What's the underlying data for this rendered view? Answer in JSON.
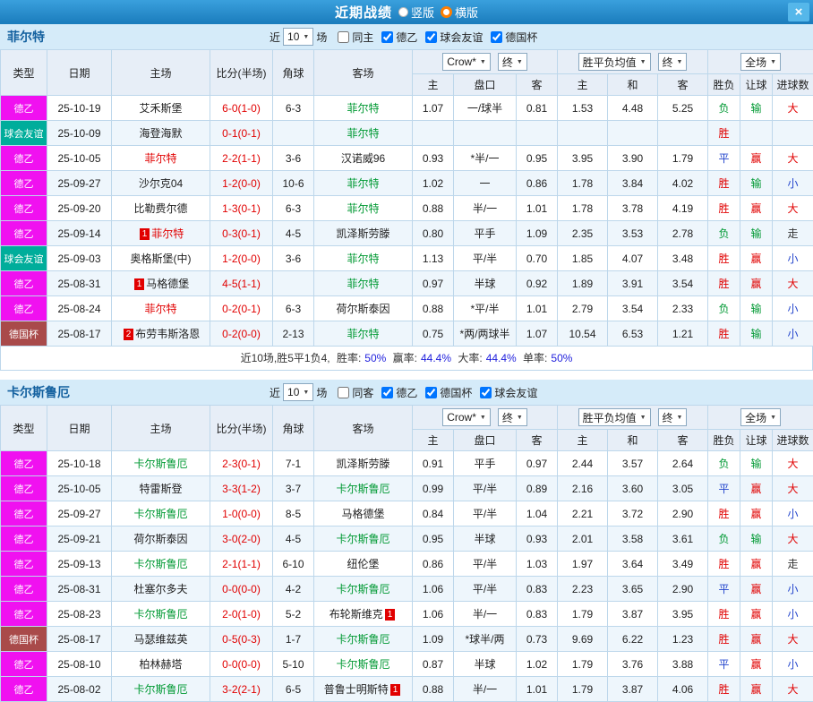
{
  "titlebar": {
    "title": "近期战绩",
    "vertical": "竖版",
    "horizontal": "横版",
    "close": "×"
  },
  "colors": {
    "header_bar": "#2187c8",
    "section_bar": "#d5ebf9",
    "grid": "#bdd7eb",
    "l2": "#f011f0",
    "fr": "#00ad9b",
    "cup": "#a94a4a",
    "red": "#e10000",
    "green": "#009933",
    "blue": "#2244cc",
    "black": "#222222",
    "dark": "#333333",
    "percent": "#2222dd",
    "orange": "#ff7e00"
  },
  "sections": [
    {
      "team": "菲尔特",
      "filter": {
        "near": "近",
        "count": "10",
        "games": "场",
        "checkboxes": [
          {
            "label": "同主",
            "checked": false
          },
          {
            "label": "德乙",
            "checked": true
          },
          {
            "label": "球会友谊",
            "checked": true
          },
          {
            "label": "德国杯",
            "checked": true
          }
        ]
      },
      "header": {
        "type": "类型",
        "date": "日期",
        "home": "主场",
        "score": "比分(半场)",
        "corner": "角球",
        "away": "客场",
        "odds_src": "Crow*",
        "odds_final": "终",
        "odds_cols": [
          "主",
          "盘口",
          "客"
        ],
        "avg_src": "胜平负均值",
        "avg_final": "终",
        "avg_cols": [
          "主",
          "和",
          "客"
        ],
        "scope": "全场",
        "result_cols": [
          "胜负",
          "让球",
          "进球数"
        ]
      },
      "rows": [
        {
          "tc": "l2",
          "type": "德乙",
          "date": "25-10-19",
          "home": "艾禾斯堡",
          "hc": "black",
          "score": "6-0(1-0)",
          "corner": "6-3",
          "away": "菲尔特",
          "ac": "green",
          "o1": "1.07",
          "o2": "一/球半",
          "o3": "0.81",
          "m1": "1.53",
          "m2": "4.48",
          "m3": "5.25",
          "rs": "负",
          "rc": "green",
          "hd": "输",
          "hdc": "green",
          "gl": "大",
          "glc": "red"
        },
        {
          "tc": "fr",
          "type": "球会友谊",
          "date": "25-10-09",
          "home": "海登海默",
          "hc": "black",
          "score": "0-1(0-1)",
          "corner": "",
          "away": "菲尔特",
          "ac": "green",
          "o1": "",
          "o2": "",
          "o3": "",
          "m1": "",
          "m2": "",
          "m3": "",
          "rs": "胜",
          "rc": "red",
          "hd": "",
          "hdc": "black",
          "gl": "",
          "glc": "black"
        },
        {
          "tc": "l2",
          "type": "德乙",
          "date": "25-10-05",
          "home": "菲尔特",
          "hc": "red",
          "score": "2-2(1-1)",
          "corner": "3-6",
          "away": "汉诺威96",
          "ac": "black",
          "o1": "0.93",
          "o2": "*半/一",
          "o3": "0.95",
          "m1": "3.95",
          "m2": "3.90",
          "m3": "1.79",
          "rs": "平",
          "rc": "blue",
          "hd": "赢",
          "hdc": "red",
          "gl": "大",
          "glc": "red"
        },
        {
          "tc": "l2",
          "type": "德乙",
          "date": "25-09-27",
          "home": "沙尔克04",
          "hc": "black",
          "score": "1-2(0-0)",
          "corner": "10-6",
          "away": "菲尔特",
          "ac": "green",
          "o1": "1.02",
          "o2": "一",
          "o3": "0.86",
          "m1": "1.78",
          "m2": "3.84",
          "m3": "4.02",
          "rs": "胜",
          "rc": "red",
          "hd": "输",
          "hdc": "green",
          "gl": "小",
          "glc": "blue"
        },
        {
          "tc": "l2",
          "type": "德乙",
          "date": "25-09-20",
          "home": "比勒费尔德",
          "hc": "black",
          "score": "1-3(0-1)",
          "corner": "6-3",
          "away": "菲尔特",
          "ac": "green",
          "o1": "0.88",
          "o2": "半/一",
          "o3": "1.01",
          "m1": "1.78",
          "m2": "3.78",
          "m3": "4.19",
          "rs": "胜",
          "rc": "red",
          "hd": "赢",
          "hdc": "red",
          "gl": "大",
          "glc": "red"
        },
        {
          "tc": "l2",
          "type": "德乙",
          "date": "25-09-14",
          "home": "菲尔特",
          "hc": "red",
          "hb": "1",
          "score": "0-3(0-1)",
          "corner": "4-5",
          "away": "凯泽斯劳滕",
          "ac": "black",
          "o1": "0.80",
          "o2": "平手",
          "o3": "1.09",
          "m1": "2.35",
          "m2": "3.53",
          "m3": "2.78",
          "rs": "负",
          "rc": "green",
          "hd": "输",
          "hdc": "green",
          "gl": "走",
          "glc": "dark"
        },
        {
          "tc": "fr",
          "type": "球会友谊",
          "date": "25-09-03",
          "home": "奥格斯堡(中)",
          "hc": "black",
          "score": "1-2(0-0)",
          "corner": "3-6",
          "away": "菲尔特",
          "ac": "green",
          "o1": "1.13",
          "o2": "平/半",
          "o3": "0.70",
          "m1": "1.85",
          "m2": "4.07",
          "m3": "3.48",
          "rs": "胜",
          "rc": "red",
          "hd": "赢",
          "hdc": "red",
          "gl": "小",
          "glc": "blue"
        },
        {
          "tc": "l2",
          "type": "德乙",
          "date": "25-08-31",
          "home": "马格德堡",
          "hc": "black",
          "hb": "1",
          "score": "4-5(1-1)",
          "corner": "",
          "away": "菲尔特",
          "ac": "green",
          "o1": "0.97",
          "o2": "半球",
          "o3": "0.92",
          "m1": "1.89",
          "m2": "3.91",
          "m3": "3.54",
          "rs": "胜",
          "rc": "red",
          "hd": "赢",
          "hdc": "red",
          "gl": "大",
          "glc": "red"
        },
        {
          "tc": "l2",
          "type": "德乙",
          "date": "25-08-24",
          "home": "菲尔特",
          "hc": "red",
          "score": "0-2(0-1)",
          "corner": "6-3",
          "away": "荷尔斯泰因",
          "ac": "black",
          "o1": "0.88",
          "o2": "*平/半",
          "o3": "1.01",
          "m1": "2.79",
          "m2": "3.54",
          "m3": "2.33",
          "rs": "负",
          "rc": "green",
          "hd": "输",
          "hdc": "green",
          "gl": "小",
          "glc": "blue"
        },
        {
          "tc": "cup",
          "type": "德国杯",
          "date": "25-08-17",
          "home": "布劳韦斯洛恩",
          "hc": "black",
          "hb": "2",
          "score": "0-2(0-0)",
          "corner": "2-13",
          "away": "菲尔特",
          "ac": "green",
          "o1": "0.75",
          "o2": "*两/两球半",
          "o3": "1.07",
          "m1": "10.54",
          "m2": "6.53",
          "m3": "1.21",
          "rs": "胜",
          "rc": "red",
          "hd": "输",
          "hdc": "green",
          "gl": "小",
          "glc": "blue"
        }
      ],
      "summary": {
        "prefix": "近10场,胜5平1负4,",
        "items": [
          {
            "label": "胜率:",
            "value": "50%"
          },
          {
            "label": "赢率:",
            "value": "44.4%"
          },
          {
            "label": "大率:",
            "value": "44.4%"
          },
          {
            "label": "单率:",
            "value": "50%"
          }
        ]
      }
    },
    {
      "team": "卡尔斯鲁厄",
      "filter": {
        "near": "近",
        "count": "10",
        "games": "场",
        "checkboxes": [
          {
            "label": "同客",
            "checked": false
          },
          {
            "label": "德乙",
            "checked": true
          },
          {
            "label": "德国杯",
            "checked": true
          },
          {
            "label": "球会友谊",
            "checked": true
          }
        ]
      },
      "header": {
        "type": "类型",
        "date": "日期",
        "home": "主场",
        "score": "比分(半场)",
        "corner": "角球",
        "away": "客场",
        "odds_src": "Crow*",
        "odds_final": "终",
        "odds_cols": [
          "主",
          "盘口",
          "客"
        ],
        "avg_src": "胜平负均值",
        "avg_final": "终",
        "avg_cols": [
          "主",
          "和",
          "客"
        ],
        "scope": "全场",
        "result_cols": [
          "胜负",
          "让球",
          "进球数"
        ]
      },
      "rows": [
        {
          "tc": "l2",
          "type": "德乙",
          "date": "25-10-18",
          "home": "卡尔斯鲁厄",
          "hc": "green",
          "score": "2-3(0-1)",
          "corner": "7-1",
          "away": "凯泽斯劳滕",
          "ac": "black",
          "o1": "0.91",
          "o2": "平手",
          "o3": "0.97",
          "m1": "2.44",
          "m2": "3.57",
          "m3": "2.64",
          "rs": "负",
          "rc": "green",
          "hd": "输",
          "hdc": "green",
          "gl": "大",
          "glc": "red"
        },
        {
          "tc": "l2",
          "type": "德乙",
          "date": "25-10-05",
          "home": "特雷斯登",
          "hc": "black",
          "score": "3-3(1-2)",
          "corner": "3-7",
          "away": "卡尔斯鲁厄",
          "ac": "green",
          "o1": "0.99",
          "o2": "平/半",
          "o3": "0.89",
          "m1": "2.16",
          "m2": "3.60",
          "m3": "3.05",
          "rs": "平",
          "rc": "blue",
          "hd": "赢",
          "hdc": "red",
          "gl": "大",
          "glc": "red"
        },
        {
          "tc": "l2",
          "type": "德乙",
          "date": "25-09-27",
          "home": "卡尔斯鲁厄",
          "hc": "green",
          "score": "1-0(0-0)",
          "corner": "8-5",
          "away": "马格德堡",
          "ac": "black",
          "o1": "0.84",
          "o2": "平/半",
          "o3": "1.04",
          "m1": "2.21",
          "m2": "3.72",
          "m3": "2.90",
          "rs": "胜",
          "rc": "red",
          "hd": "赢",
          "hdc": "red",
          "gl": "小",
          "glc": "blue"
        },
        {
          "tc": "l2",
          "type": "德乙",
          "date": "25-09-21",
          "home": "荷尔斯泰因",
          "hc": "black",
          "score": "3-0(2-0)",
          "corner": "4-5",
          "away": "卡尔斯鲁厄",
          "ac": "green",
          "o1": "0.95",
          "o2": "半球",
          "o3": "0.93",
          "m1": "2.01",
          "m2": "3.58",
          "m3": "3.61",
          "rs": "负",
          "rc": "green",
          "hd": "输",
          "hdc": "green",
          "gl": "大",
          "glc": "red"
        },
        {
          "tc": "l2",
          "type": "德乙",
          "date": "25-09-13",
          "home": "卡尔斯鲁厄",
          "hc": "green",
          "score": "2-1(1-1)",
          "corner": "6-10",
          "away": "纽伦堡",
          "ac": "black",
          "o1": "0.86",
          "o2": "平/半",
          "o3": "1.03",
          "m1": "1.97",
          "m2": "3.64",
          "m3": "3.49",
          "rs": "胜",
          "rc": "red",
          "hd": "赢",
          "hdc": "red",
          "gl": "走",
          "glc": "dark"
        },
        {
          "tc": "l2",
          "type": "德乙",
          "date": "25-08-31",
          "home": "杜塞尔多夫",
          "hc": "black",
          "score": "0-0(0-0)",
          "corner": "4-2",
          "away": "卡尔斯鲁厄",
          "ac": "green",
          "o1": "1.06",
          "o2": "平/半",
          "o3": "0.83",
          "m1": "2.23",
          "m2": "3.65",
          "m3": "2.90",
          "rs": "平",
          "rc": "blue",
          "hd": "赢",
          "hdc": "red",
          "gl": "小",
          "glc": "blue"
        },
        {
          "tc": "l2",
          "type": "德乙",
          "date": "25-08-23",
          "home": "卡尔斯鲁厄",
          "hc": "green",
          "score": "2-0(1-0)",
          "corner": "5-2",
          "away": "布轮斯维克",
          "ac": "black",
          "ab": "1",
          "o1": "1.06",
          "o2": "半/一",
          "o3": "0.83",
          "m1": "1.79",
          "m2": "3.87",
          "m3": "3.95",
          "rs": "胜",
          "rc": "red",
          "hd": "赢",
          "hdc": "red",
          "gl": "小",
          "glc": "blue"
        },
        {
          "tc": "cup",
          "type": "德国杯",
          "date": "25-08-17",
          "home": "马瑟维兹英",
          "hc": "black",
          "score": "0-5(0-3)",
          "corner": "1-7",
          "away": "卡尔斯鲁厄",
          "ac": "green",
          "o1": "1.09",
          "o2": "*球半/两",
          "o3": "0.73",
          "m1": "9.69",
          "m2": "6.22",
          "m3": "1.23",
          "rs": "胜",
          "rc": "red",
          "hd": "赢",
          "hdc": "red",
          "gl": "大",
          "glc": "red"
        },
        {
          "tc": "l2",
          "type": "德乙",
          "date": "25-08-10",
          "home": "柏林赫塔",
          "hc": "black",
          "score": "0-0(0-0)",
          "corner": "5-10",
          "away": "卡尔斯鲁厄",
          "ac": "green",
          "o1": "0.87",
          "o2": "半球",
          "o3": "1.02",
          "m1": "1.79",
          "m2": "3.76",
          "m3": "3.88",
          "rs": "平",
          "rc": "blue",
          "hd": "赢",
          "hdc": "red",
          "gl": "小",
          "glc": "blue"
        },
        {
          "tc": "l2",
          "type": "德乙",
          "date": "25-08-02",
          "home": "卡尔斯鲁厄",
          "hc": "green",
          "score": "3-2(2-1)",
          "corner": "6-5",
          "away": "普鲁士明斯特",
          "ac": "black",
          "ab": "1",
          "o1": "0.88",
          "o2": "半/一",
          "o3": "1.01",
          "m1": "1.79",
          "m2": "3.87",
          "m3": "4.06",
          "rs": "胜",
          "rc": "red",
          "hd": "赢",
          "hdc": "red",
          "gl": "大",
          "glc": "red"
        }
      ]
    }
  ]
}
